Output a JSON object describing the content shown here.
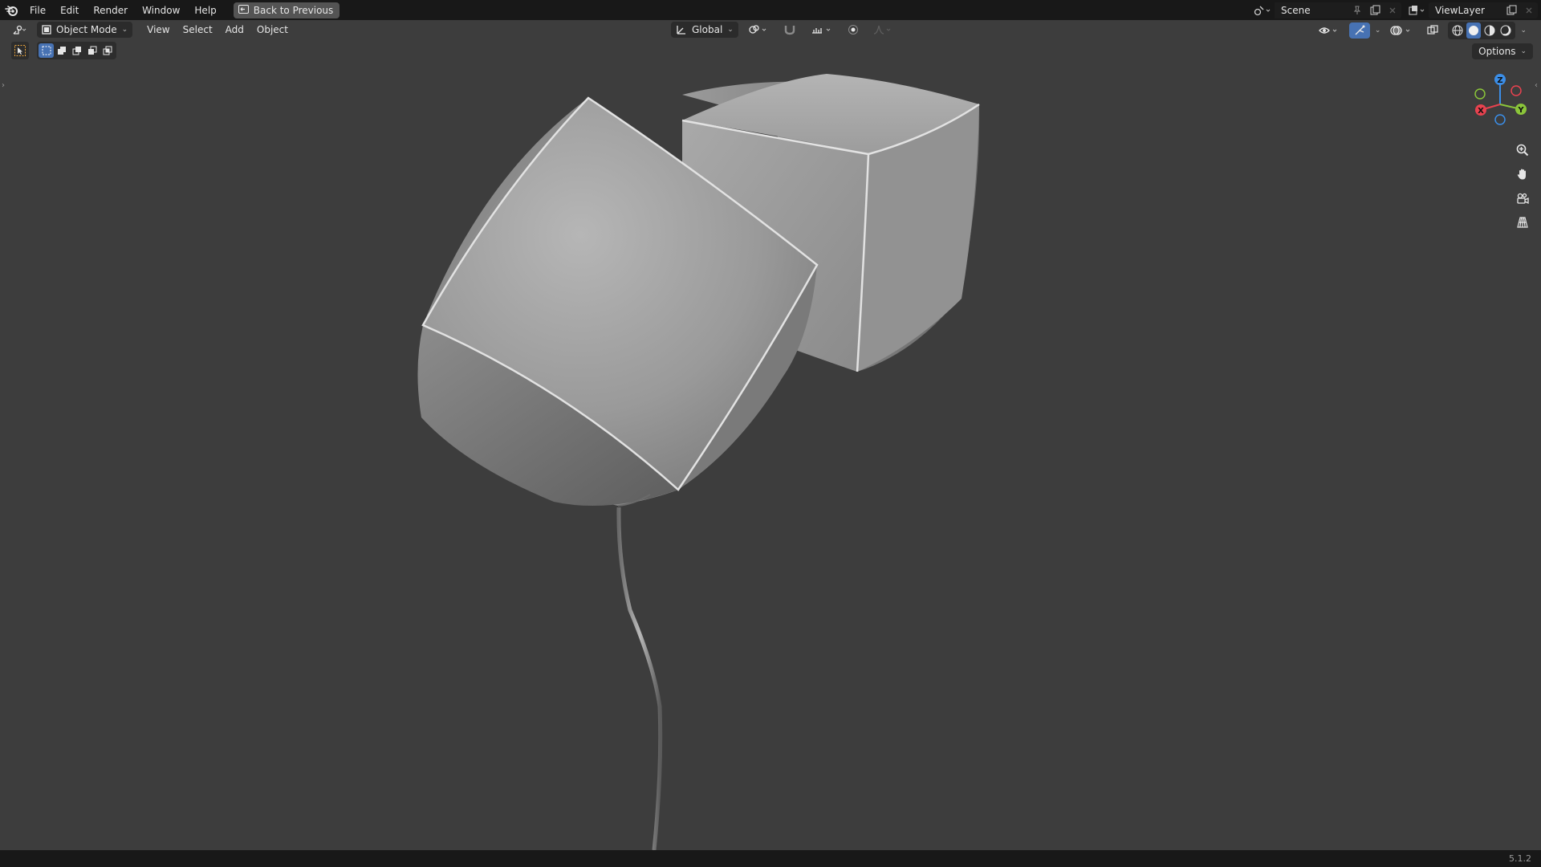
{
  "topbar": {
    "menus": [
      "File",
      "Edit",
      "Render",
      "Window",
      "Help"
    ],
    "back_label": "Back to Previous",
    "scene_name": "Scene",
    "view_layer": "ViewLayer"
  },
  "header": {
    "mode": "Object Mode",
    "menus": [
      "View",
      "Select",
      "Add",
      "Object"
    ],
    "transform_orientation": "Global",
    "options_label": "Options"
  },
  "gizmo": {
    "axes": {
      "x": "X",
      "y": "Y",
      "z": "Z"
    },
    "colors": {
      "x": "#e8424f",
      "y": "#8bc53a",
      "z": "#3b8ee8"
    }
  },
  "status": {
    "version": "5.1.2"
  },
  "colors": {
    "viewport_bg": "#3d3d3d",
    "bar_bg": "#181818",
    "accent": "#4772b3"
  }
}
